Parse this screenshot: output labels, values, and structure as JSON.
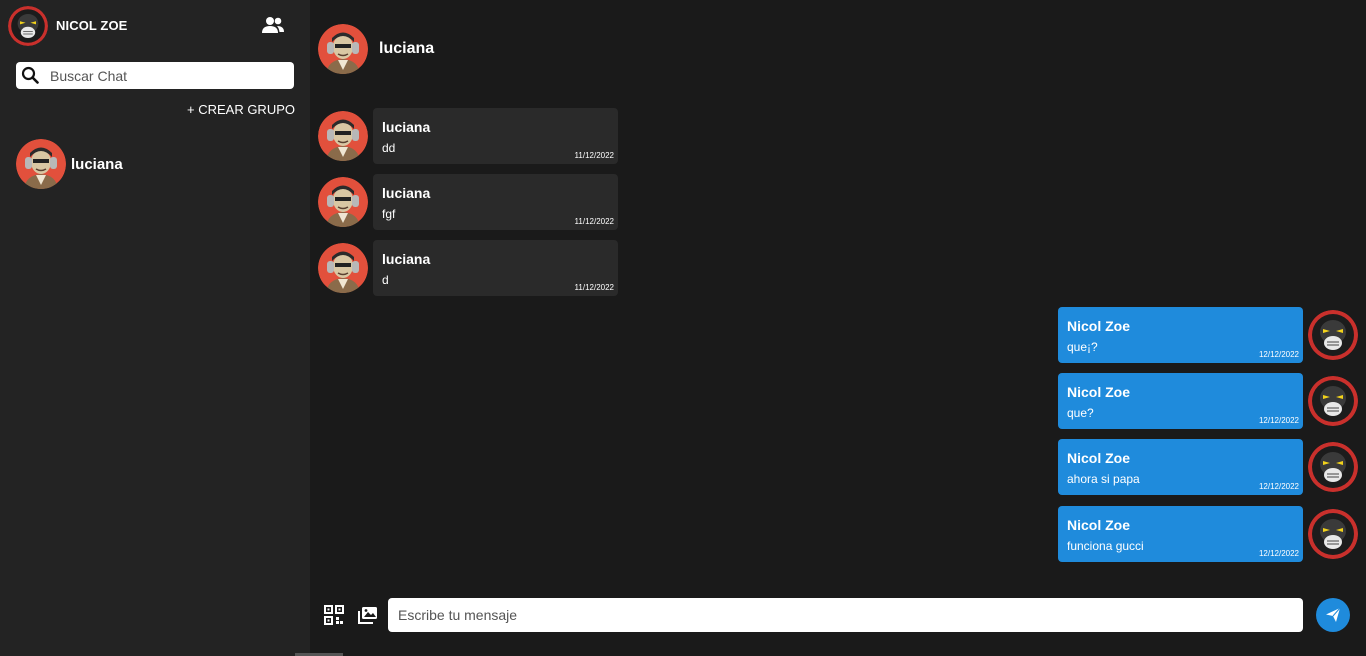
{
  "current_user": {
    "name": "NICOL ZOE"
  },
  "search": {
    "placeholder": "Buscar Chat"
  },
  "sidebar": {
    "create_group_label": "+ CREAR GRUPO"
  },
  "chats": [
    {
      "name": "luciana"
    }
  ],
  "active_chat": {
    "name": "luciana"
  },
  "messages": [
    {
      "sender": "luciana",
      "text": "dd",
      "date": "11/12/2022",
      "direction": "incoming"
    },
    {
      "sender": "luciana",
      "text": "fgf",
      "date": "11/12/2022",
      "direction": "incoming"
    },
    {
      "sender": "luciana",
      "text": "d",
      "date": "11/12/2022",
      "direction": "incoming"
    },
    {
      "sender": "Nicol Zoe",
      "text": "que¡?",
      "date": "12/12/2022",
      "direction": "outgoing"
    },
    {
      "sender": "Nicol Zoe",
      "text": "que?",
      "date": "12/12/2022",
      "direction": "outgoing"
    },
    {
      "sender": "Nicol Zoe",
      "text": "ahora si papa",
      "date": "12/12/2022",
      "direction": "outgoing"
    },
    {
      "sender": "Nicol Zoe",
      "text": "funciona gucci",
      "date": "12/12/2022",
      "direction": "outgoing"
    }
  ],
  "composer": {
    "placeholder": "Escribe tu mensaje"
  },
  "icons": {
    "contacts": "users-icon",
    "search": "search-icon",
    "qr": "qr-code-icon",
    "image": "image-icon",
    "send": "send-icon"
  },
  "colors": {
    "outgoing_bubble": "#1f8bdc",
    "incoming_bubble": "#2a2a2a",
    "sidebar_bg": "#232323",
    "main_bg": "#1a1a1a",
    "avatar_ring": "#e2503c"
  }
}
